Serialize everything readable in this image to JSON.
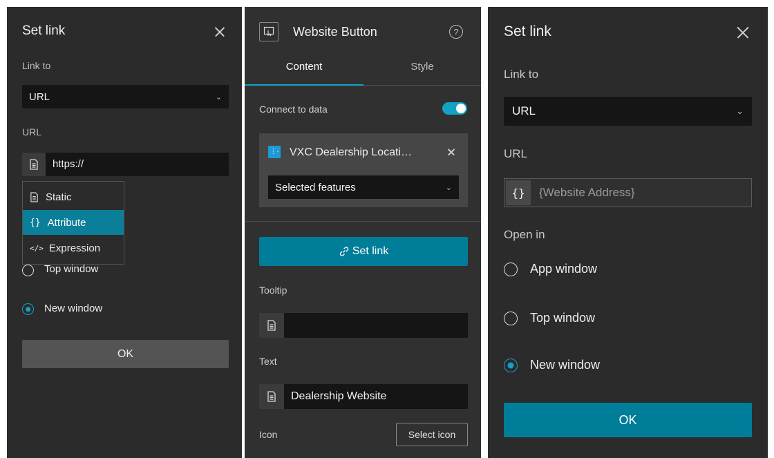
{
  "left_dialog": {
    "title": "Set link",
    "link_to_label": "Link to",
    "link_to_value": "URL",
    "url_label": "URL",
    "url_value": "https://",
    "dropdown_menu": [
      "Static",
      "Attribute",
      "Expression"
    ],
    "dropdown_selected": "Attribute",
    "radio_top": "Top window",
    "radio_new": "New window",
    "ok_label": "OK"
  },
  "middle_panel": {
    "title": "Website Button",
    "tabs": [
      {
        "label": "Content",
        "active": true
      },
      {
        "label": "Style",
        "active": false
      }
    ],
    "connect_label": "Connect to data",
    "connect_on": true,
    "datasource_name": "VXC Dealership Locati…",
    "selection_value": "Selected features",
    "set_link_label": "Set link",
    "tooltip_label": "Tooltip",
    "tooltip_value": "",
    "text_label": "Text",
    "text_value": "Dealership Website",
    "icon_label": "Icon",
    "select_icon_label": "Select icon"
  },
  "right_dialog": {
    "title": "Set link",
    "link_to_label": "Link to",
    "link_to_value": "URL",
    "url_label": "URL",
    "url_mode_glyph": "{}",
    "url_value": "{Website Address}",
    "open_in_label": "Open in",
    "radio_app": "App window",
    "radio_top": "Top window",
    "radio_new": "New window",
    "selected_option": "New window",
    "ok_label": "OK"
  },
  "colors": {
    "panel_bg": "#2b2b2b",
    "field_bg": "#151515",
    "accent": "#007d99",
    "radio_accent": "#13a1c4"
  }
}
